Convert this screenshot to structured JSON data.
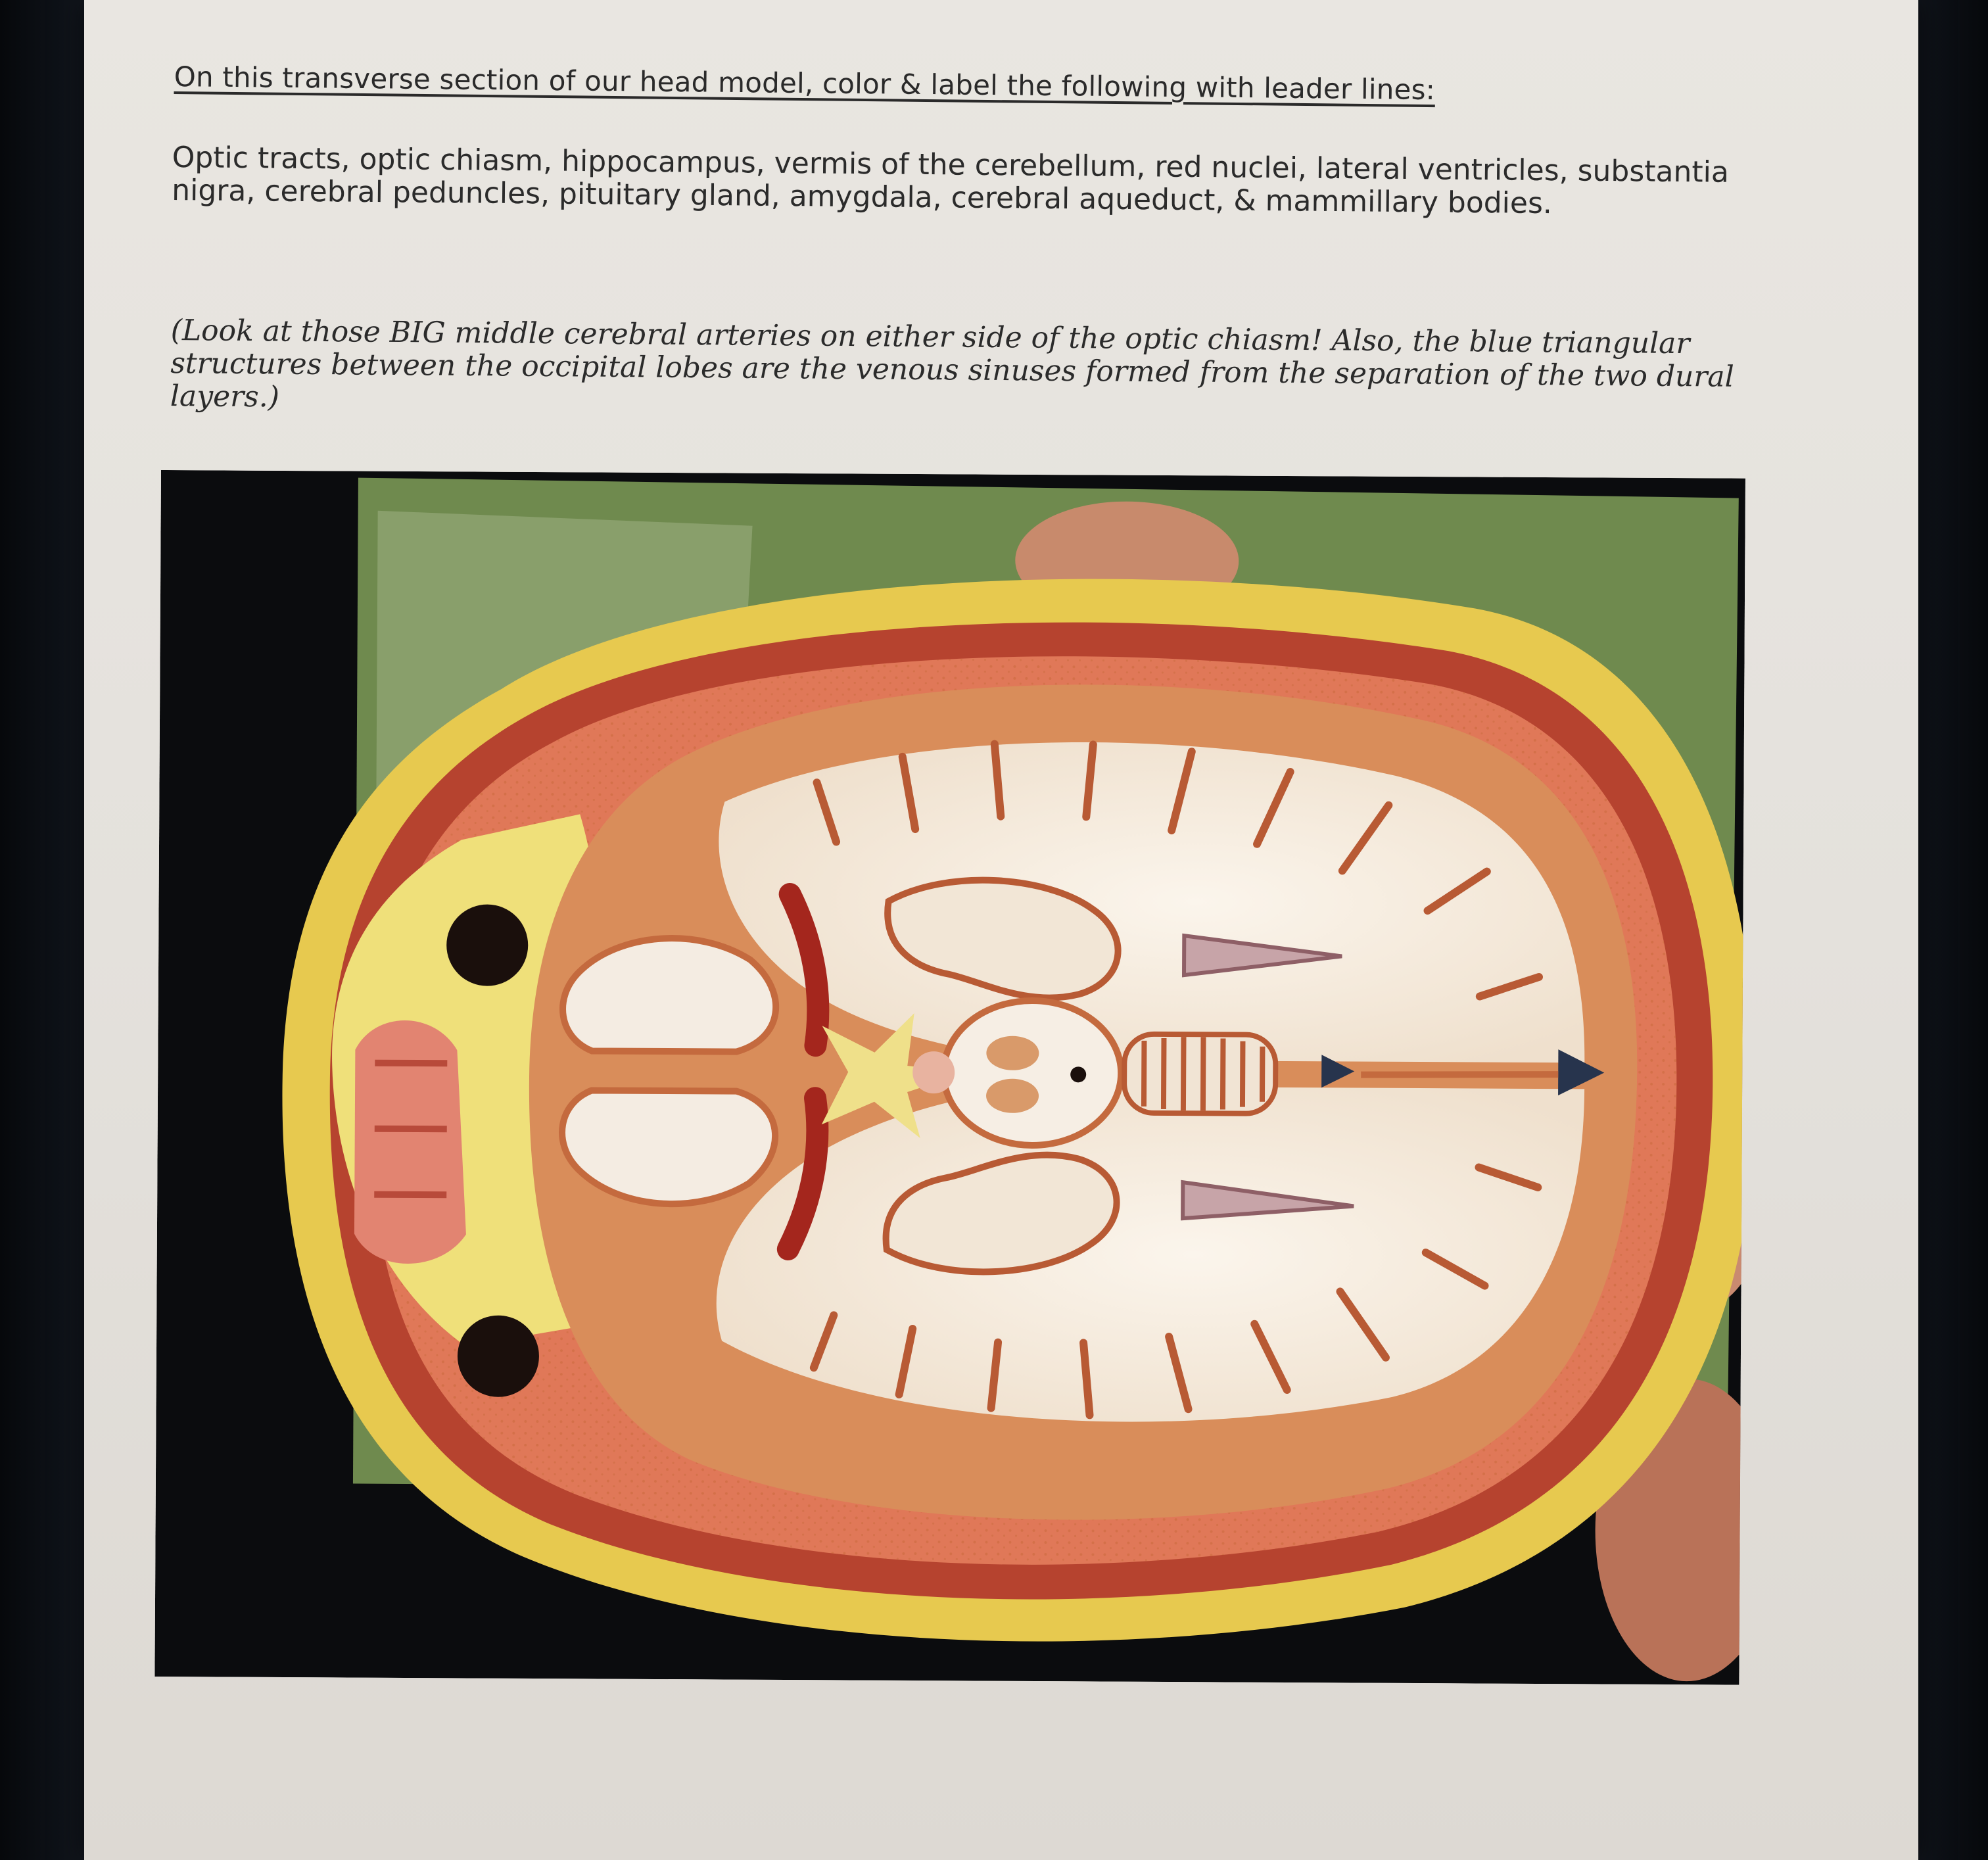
{
  "document": {
    "heading": "On this transverse section of our head model, color & label the following with leader lines:",
    "structures_text": "Optic tracts, optic chiasm, hippocampus, vermis of the cerebellum, red nuclei, lateral ventricles, substantia nigra, cerebral peduncles, pituitary gland, amygdala, cerebral aqueduct, & mammillary bodies.",
    "note": "(Look at those BIG middle cerebral arteries on either side of the optic chiasm! Also, the blue triangular structures between the occipital lobes are the venous sinuses formed from the separation of the two dural layers.)"
  },
  "photo": {
    "subject": "transverse-section-head-model",
    "colors": {
      "background_dark": "#0b0c0e",
      "green_board": "#6f8a4e",
      "skin_yellow": "#e9cf55",
      "muscle_red": "#b6432f",
      "white_matter": "#f4ece2",
      "gray_matter": "#d98d5a",
      "venous_blue": "#27344d"
    }
  }
}
